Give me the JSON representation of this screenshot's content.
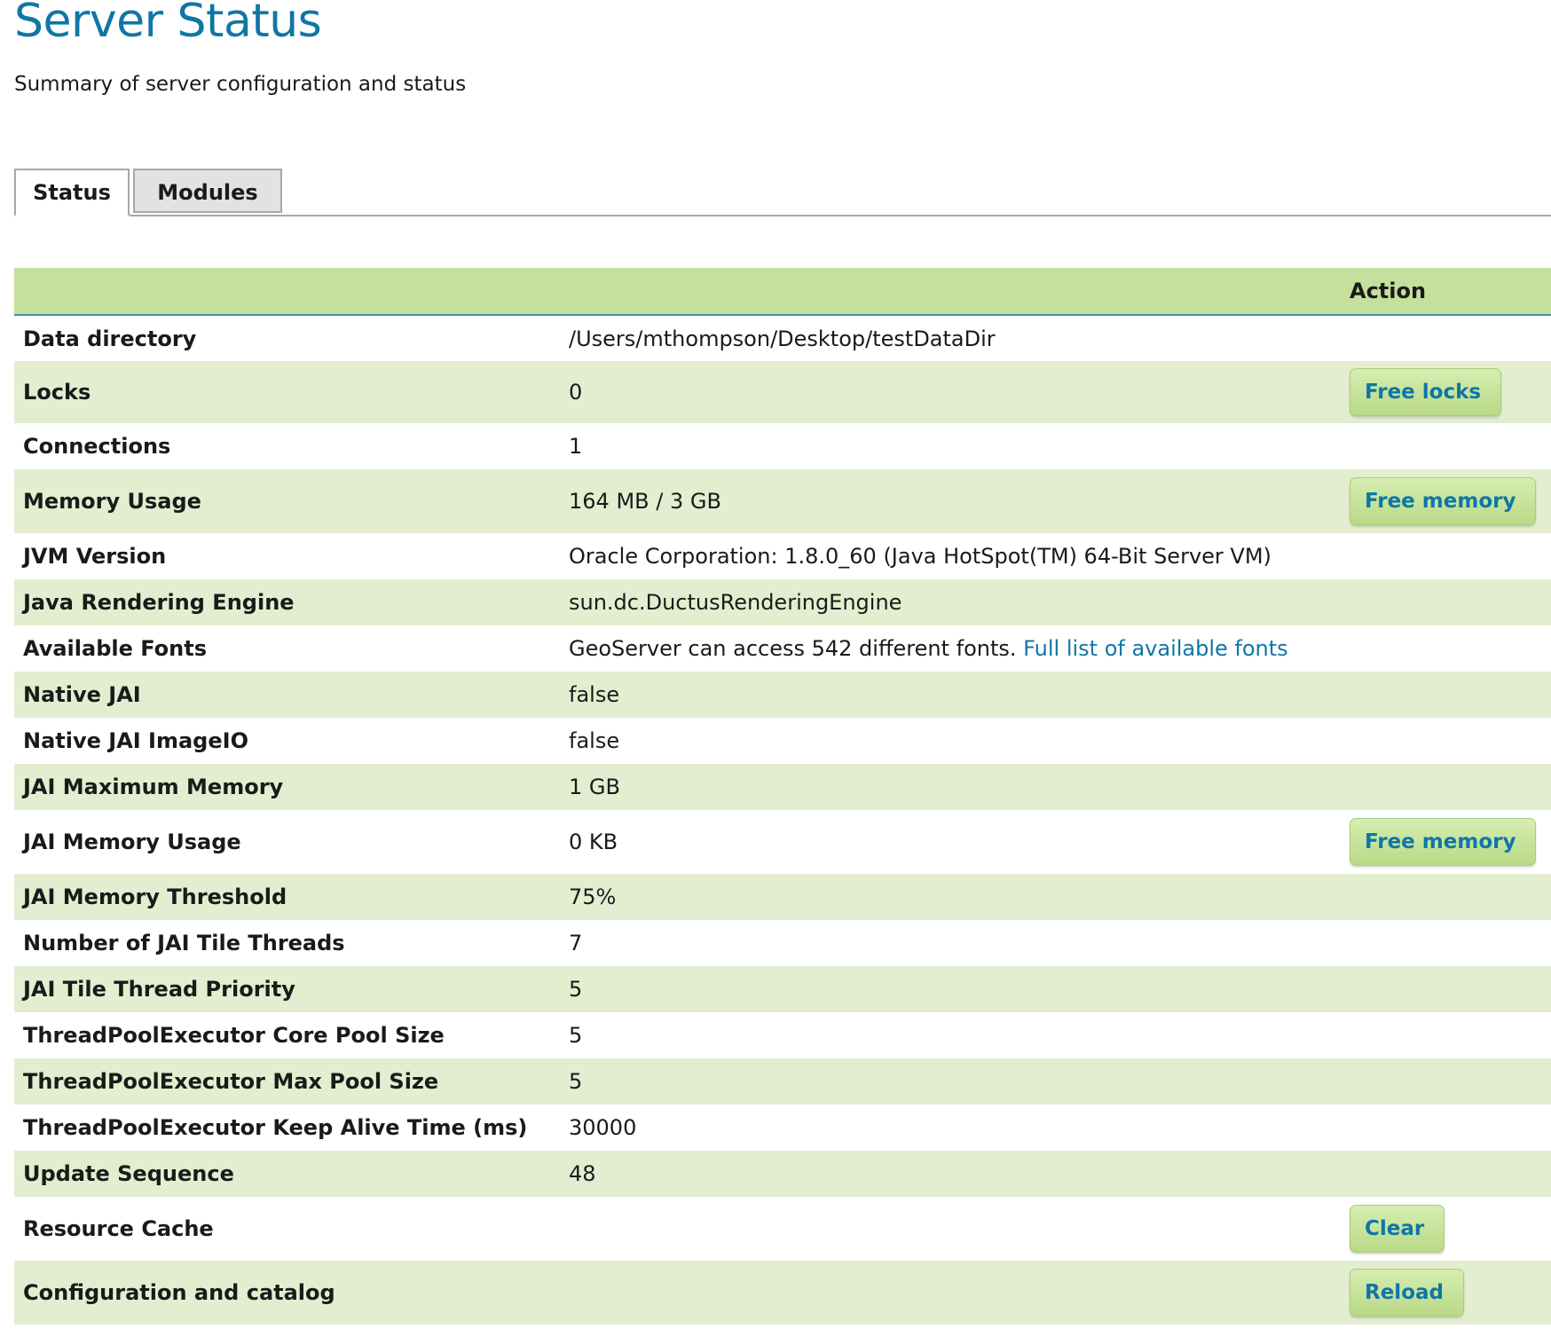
{
  "page": {
    "title": "Server Status",
    "subtitle": "Summary of server configuration and status"
  },
  "tabs": [
    {
      "label": "Status",
      "active": true
    },
    {
      "label": "Modules",
      "active": false
    }
  ],
  "table": {
    "header": {
      "label": "",
      "value": "",
      "action": "Action"
    },
    "rows": [
      {
        "label": "Data directory",
        "value": "/Users/mthompson/Desktop/testDataDir",
        "action": ""
      },
      {
        "label": "Locks",
        "value": "0",
        "action": "Free locks"
      },
      {
        "label": "Connections",
        "value": "1",
        "action": ""
      },
      {
        "label": "Memory Usage",
        "value": "164 MB / 3 GB",
        "action": "Free memory"
      },
      {
        "label": "JVM Version",
        "value": "Oracle Corporation: 1.8.0_60 (Java HotSpot(TM) 64-Bit Server VM)",
        "action": ""
      },
      {
        "label": "Java Rendering Engine",
        "value": "sun.dc.DuctusRenderingEngine",
        "action": ""
      },
      {
        "label": "Available Fonts",
        "value": "GeoServer can access 542 different fonts.",
        "link": "Full list of available fonts",
        "action": ""
      },
      {
        "label": "Native JAI",
        "value": "false",
        "action": ""
      },
      {
        "label": "Native JAI ImageIO",
        "value": "false",
        "action": ""
      },
      {
        "label": "JAI Maximum Memory",
        "value": "1 GB",
        "action": ""
      },
      {
        "label": "JAI Memory Usage",
        "value": "0 KB",
        "action": "Free memory"
      },
      {
        "label": "JAI Memory Threshold",
        "value": "75%",
        "action": ""
      },
      {
        "label": "Number of JAI Tile Threads",
        "value": "7",
        "action": ""
      },
      {
        "label": "JAI Tile Thread Priority",
        "value": "5",
        "action": ""
      },
      {
        "label": "ThreadPoolExecutor Core Pool Size",
        "value": "5",
        "action": ""
      },
      {
        "label": "ThreadPoolExecutor Max Pool Size",
        "value": "5",
        "action": ""
      },
      {
        "label": "ThreadPoolExecutor Keep Alive Time (ms)",
        "value": "30000",
        "action": ""
      },
      {
        "label": "Update Sequence",
        "value": "48",
        "action": ""
      },
      {
        "label": "Resource Cache",
        "value": "",
        "action": "Clear"
      },
      {
        "label": "Configuration and catalog",
        "value": "",
        "action": "Reload"
      }
    ]
  },
  "colors": {
    "title": "#0f76a6",
    "header_bg": "#c5df9c",
    "row_even_bg": "#e3eed0",
    "button_text": "#0f76a6"
  }
}
